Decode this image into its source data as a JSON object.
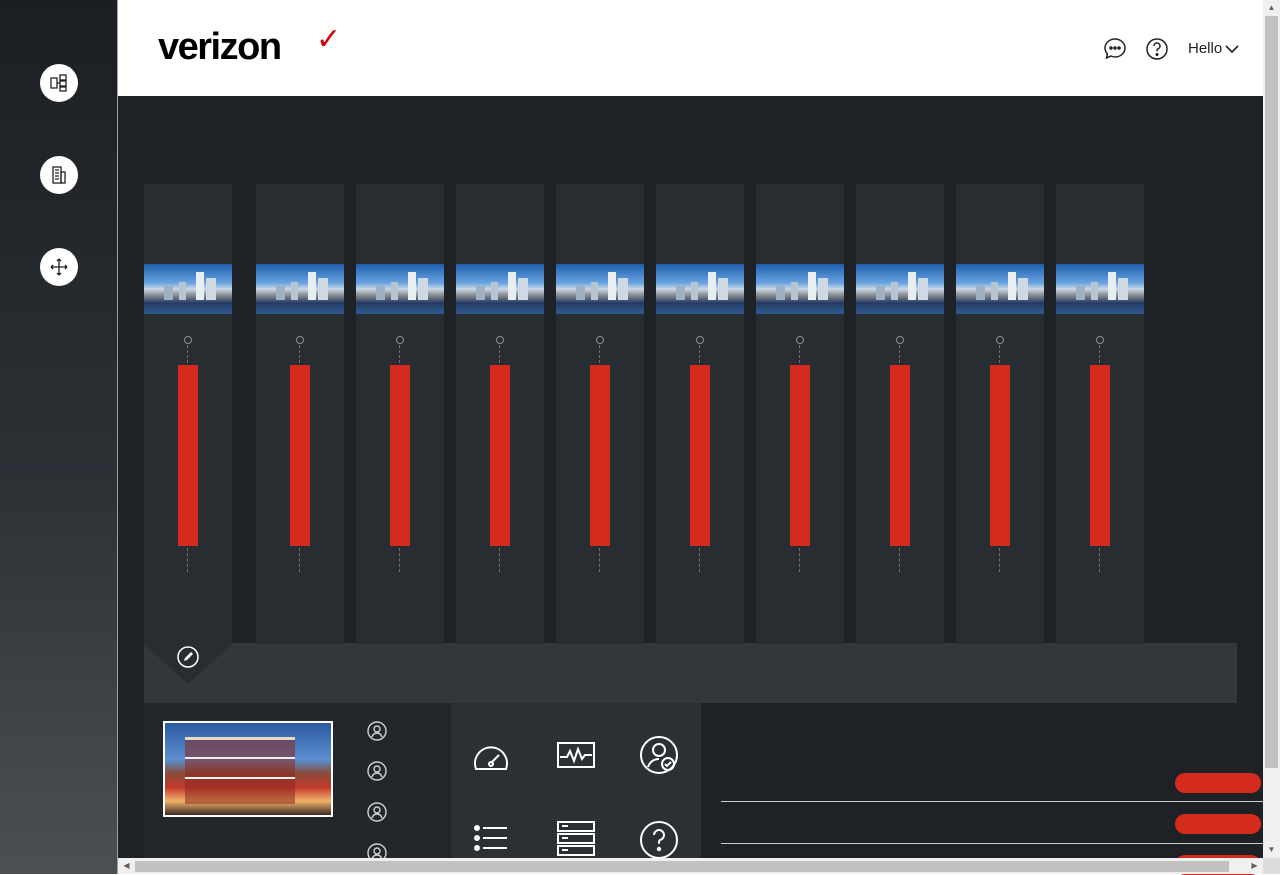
{
  "header": {
    "logo_text": "verizon",
    "logo_check": "✓",
    "greeting": "Hello",
    "icons": [
      "chat-icon",
      "help-icon",
      "chevron-down-icon"
    ]
  },
  "rail": {
    "items": [
      {
        "icon": "org-chart-icon"
      },
      {
        "icon": "building-icon"
      },
      {
        "icon": "move-arrows-icon"
      }
    ]
  },
  "towers": {
    "count": 10,
    "active_index": 0
  },
  "bottom": {
    "people_count": 4,
    "action_icons": [
      "speedometer-icon",
      "activity-icon",
      "user-check-icon",
      "list-icon",
      "server-icon",
      "help-circle-icon"
    ],
    "pill_count": 3
  },
  "colors": {
    "accent": "#d52b1e",
    "dark_bg": "#1e2226",
    "panel": "#282d32"
  }
}
